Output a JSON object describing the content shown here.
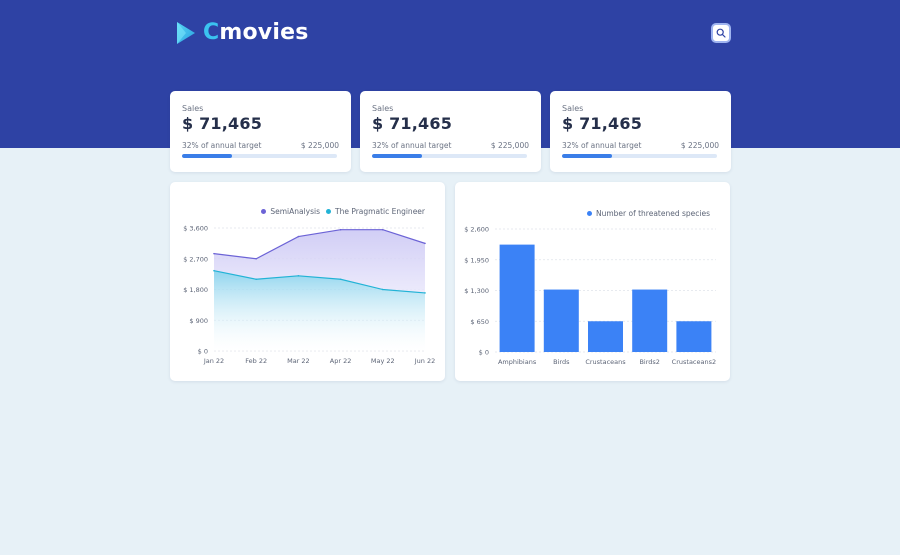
{
  "header": {
    "logo_accent": "C",
    "logo_rest": "movies",
    "search_icon": "search-icon"
  },
  "stats": [
    {
      "label": "Sales",
      "value": "$ 71,465",
      "percent_text": "32% of annual target",
      "target": "$ 225,000",
      "progress": 0.32
    },
    {
      "label": "Sales",
      "value": "$ 71,465",
      "percent_text": "32% of annual target",
      "target": "$ 225,000",
      "progress": 0.32
    },
    {
      "label": "Sales",
      "value": "$ 71,465",
      "percent_text": "32% of annual target",
      "target": "$ 225,000",
      "progress": 0.32
    }
  ],
  "colors": {
    "header_bg": "#2e42a4",
    "page_bg": "#e7f1f7",
    "accent": "#3bc3f0",
    "series_1": "#6c63d6",
    "series_2": "#22b3d6",
    "bar": "#3b82f6",
    "progress": "#3a7ee8"
  },
  "chart_data": [
    {
      "type": "area",
      "categories": [
        "Jan 22",
        "Feb 22",
        "Mar 22",
        "Apr 22",
        "May 22",
        "Jun 22"
      ],
      "series": [
        {
          "name": "SemiAnalysis",
          "values": [
            2850,
            2700,
            3350,
            3550,
            3550,
            3150
          ]
        },
        {
          "name": "The Pragmatic Engineer",
          "values": [
            2350,
            2100,
            2200,
            2100,
            1800,
            1700
          ]
        }
      ],
      "ylim": [
        0,
        3600
      ],
      "yticks": [
        "$ 0",
        "$ 900",
        "$ 1,800",
        "$ 2,700",
        "$ 3,600"
      ],
      "legend": "top-right",
      "grid": true
    },
    {
      "type": "bar",
      "categories": [
        "Amphibians",
        "Birds",
        "Crustaceans",
        "Birds2",
        "Crustaceans2"
      ],
      "series": [
        {
          "name": "Number of threatened species",
          "values": [
            2270,
            1320,
            650,
            1320,
            650
          ]
        }
      ],
      "ylim": [
        0,
        2600
      ],
      "yticks": [
        "$ 0",
        "$ 650",
        "$ 1,300",
        "$ 1,950",
        "$ 2,600"
      ],
      "legend": "top-right",
      "grid": true
    }
  ]
}
